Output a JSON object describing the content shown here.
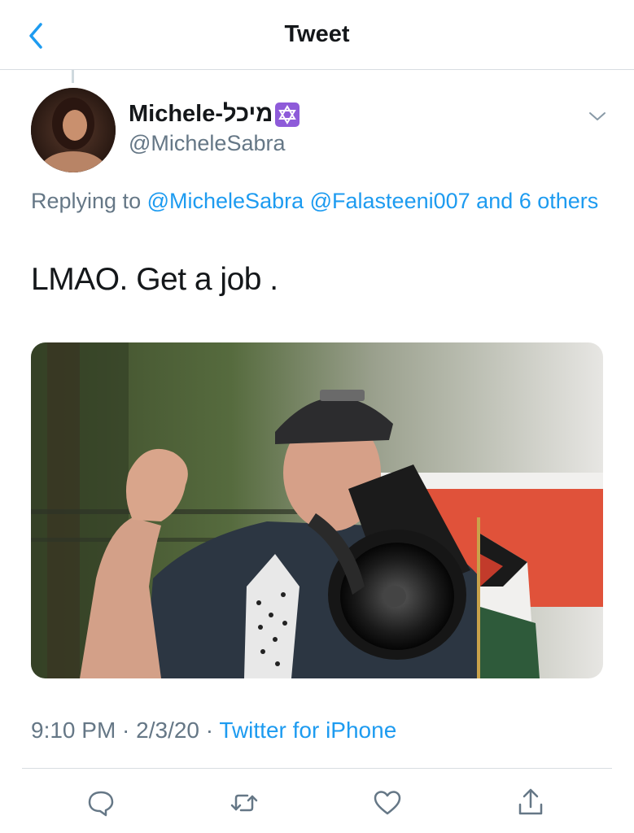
{
  "navbar": {
    "title": "Tweet",
    "back_icon": "chevron-left-icon"
  },
  "tweet": {
    "author": {
      "display_name": "Michele-מיכל",
      "badge_icon": "star-of-david-icon",
      "handle": "@MicheleSabra"
    },
    "menu_icon": "chevron-down-icon",
    "replying": {
      "prefix": "Replying to",
      "mentions": [
        "@MicheleSabra",
        "@Falasteeni007"
      ],
      "others": "and 6 others"
    },
    "text": "LMAO. Get a job .",
    "photo_icon": "photo",
    "timestamp": "9:10 PM · 2/3/20 ·",
    "source": "Twitter for iPhone"
  },
  "actions": [
    {
      "icon": "reply-icon"
    },
    {
      "icon": "retweet-icon"
    },
    {
      "icon": "like-icon"
    },
    {
      "icon": "share-icon"
    }
  ],
  "colors": {
    "link": "#1d9bf0",
    "secondary_text": "#657786",
    "primary_text": "#14171a",
    "badge": "#8e5bd9"
  }
}
